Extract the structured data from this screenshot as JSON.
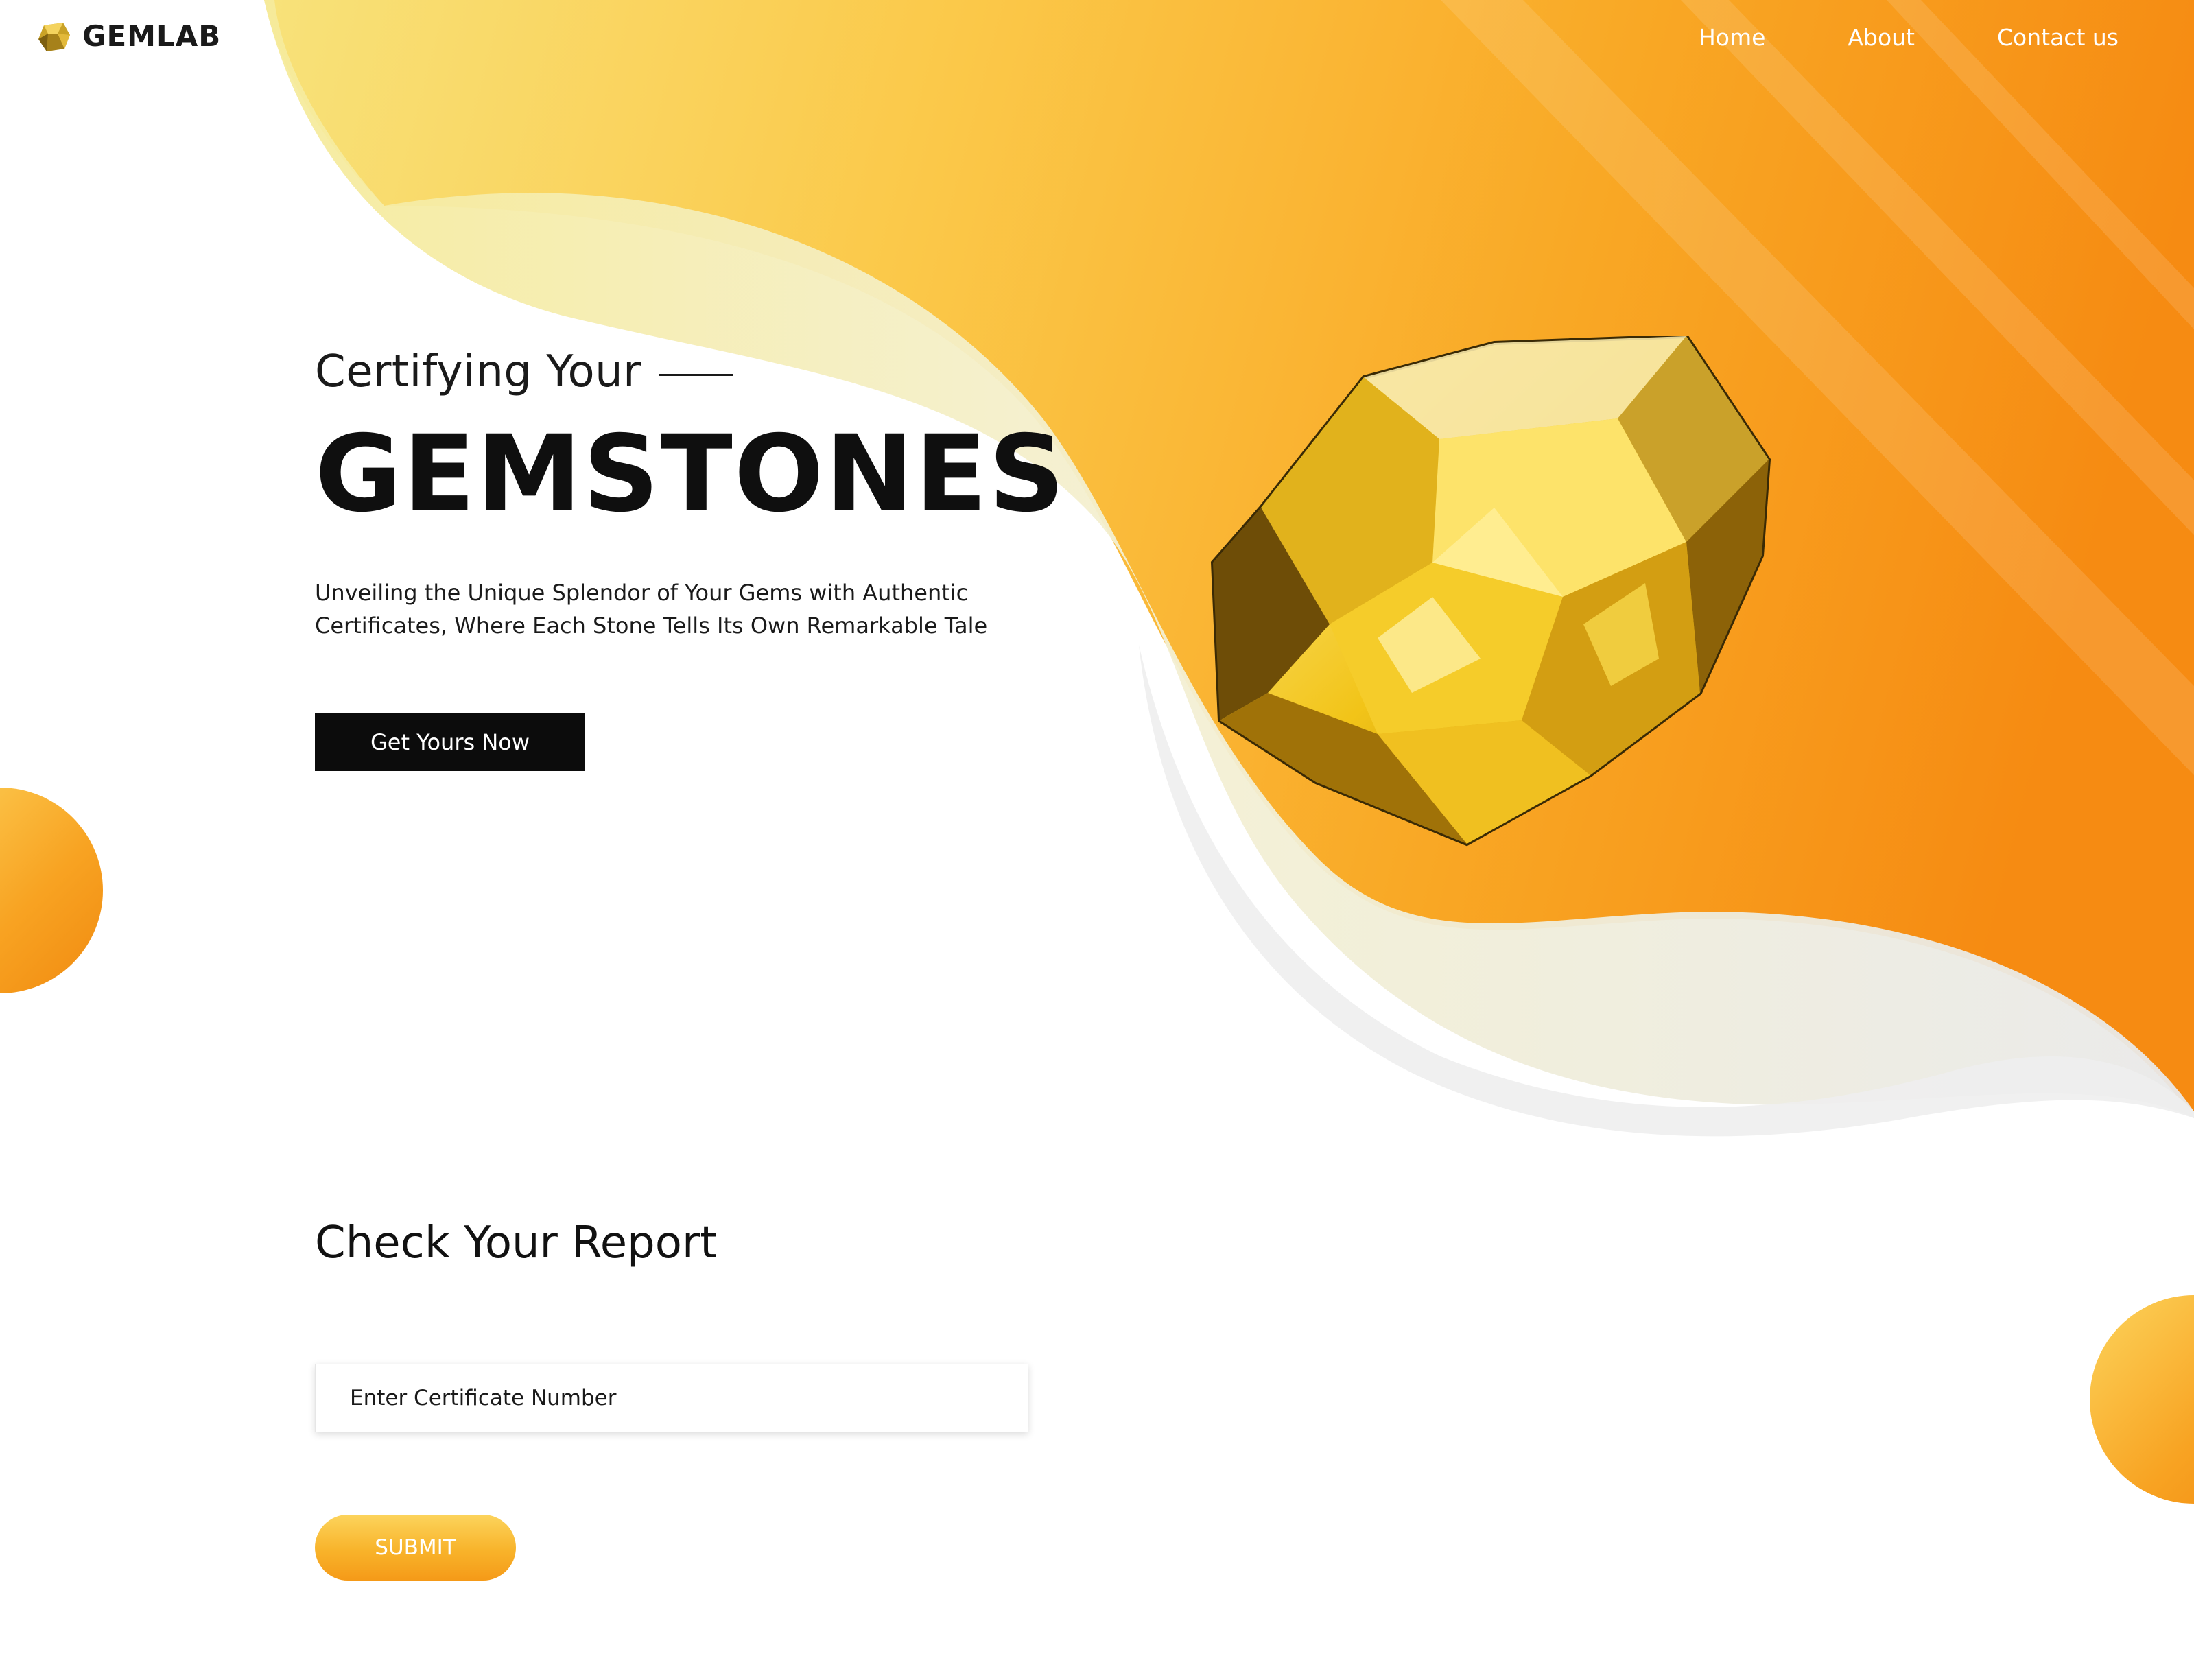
{
  "brand": {
    "name": "GEMLAB",
    "logo_icon": "gem-icon"
  },
  "nav": {
    "items": [
      {
        "label": "Home"
      },
      {
        "label": "About"
      },
      {
        "label": "Contact us"
      }
    ]
  },
  "hero": {
    "eyebrow": "Certifying Your",
    "headline": "GEMSTONES",
    "tagline": "Unveiling the Unique Splendor of Your Gems with Authentic Certificates, Where Each Stone Tells Its Own Remarkable Tale",
    "cta_label": "Get Yours Now",
    "image": "yellow-gemstone"
  },
  "report": {
    "title": "Check Your Report",
    "input_placeholder": "Enter Certificate Number",
    "submit_label": "SUBMIT"
  },
  "colors": {
    "accent_orange": "#f7941d",
    "accent_yellow": "#fcd45c",
    "dark": "#0c0c0c"
  }
}
